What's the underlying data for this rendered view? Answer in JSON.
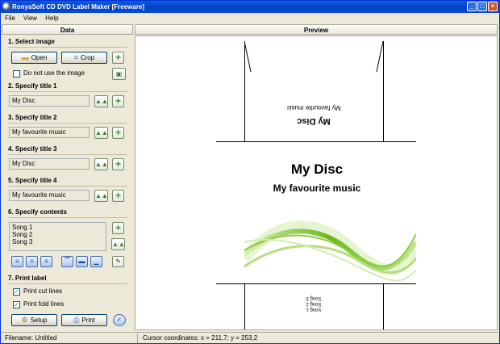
{
  "window": {
    "title": "RonyaSoft CD DVD Label Maker [Freeware]"
  },
  "menu": [
    "File",
    "View",
    "Help"
  ],
  "panels": {
    "left": "Data",
    "right": "Preview"
  },
  "section1": {
    "heading": "1. Select image",
    "open_label": "Open",
    "crop_label": "Crop",
    "checkbox_label": "Do not use the image",
    "checkbox_checked": false
  },
  "title1": {
    "heading": "2. Specify title 1",
    "value": "My Disc"
  },
  "title2": {
    "heading": "3. Specify title 2",
    "value": "My favourite music"
  },
  "title3": {
    "heading": "4. Specify title 3",
    "value": "My Disc"
  },
  "title4": {
    "heading": "5. Specify title 4",
    "value": "My favourite music"
  },
  "contents": {
    "heading": "6. Specify contents",
    "items": [
      "Song 1",
      "Song 2",
      "Song 3"
    ]
  },
  "print": {
    "heading": "7. Print label",
    "cut_label": "Print cut lines",
    "fold_label": "Print fold lines",
    "cut_checked": true,
    "fold_checked": true,
    "setup_label": "Setup",
    "print_label": "Print"
  },
  "preview": {
    "top_title": "My Disc",
    "top_subtitle": "My favourite music",
    "main_title": "My Disc",
    "main_subtitle": "My favourite music",
    "bottom_items": [
      "Song 1",
      "Song 2",
      "Song 3"
    ]
  },
  "status": {
    "filename": "Filename: Untitled",
    "cursor": "Cursor coordinates: x = 211,7; y = 253,2"
  },
  "colors": {
    "accent_green": "#6cb81e",
    "titlebar": "#0342c9"
  }
}
